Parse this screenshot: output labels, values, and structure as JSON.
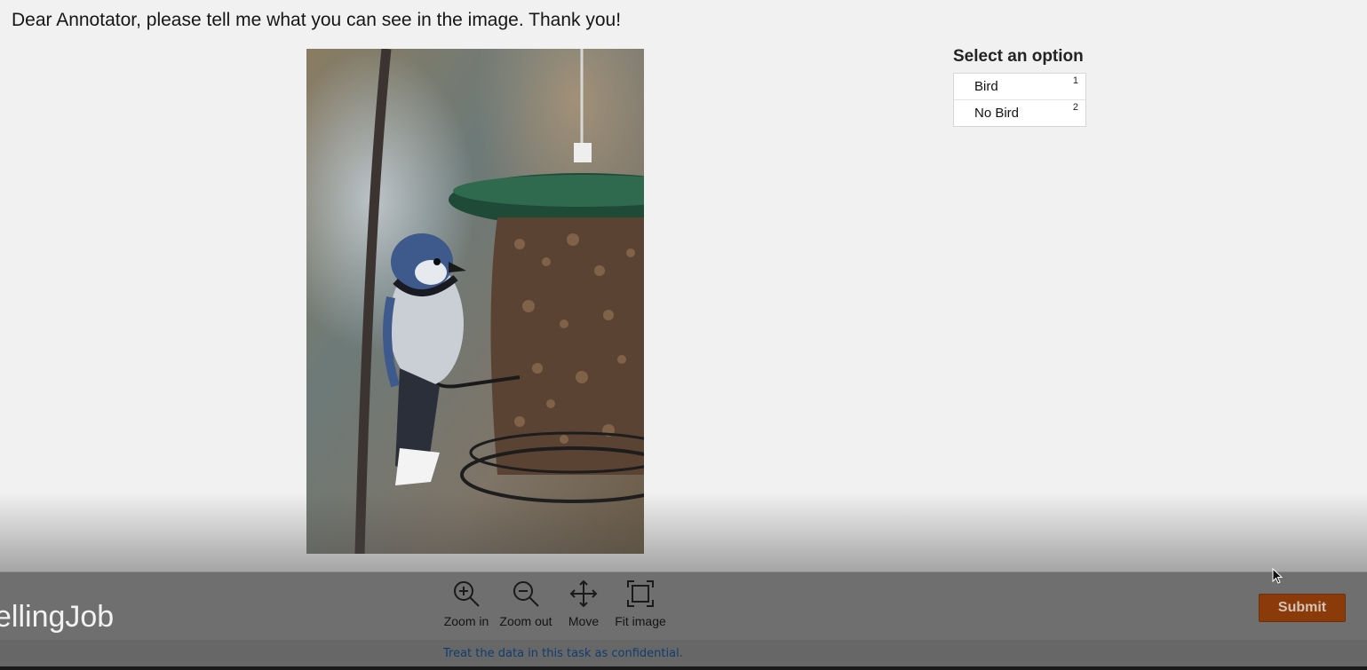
{
  "instructions": "Dear Annotator, please tell me what you can see in the image. Thank you!",
  "options": {
    "title": "Select an option",
    "items": [
      {
        "label": "Bird",
        "key": "1"
      },
      {
        "label": "No Bird",
        "key": "2"
      }
    ]
  },
  "job_title": "ellingJob",
  "tools": {
    "zoom_in": "Zoom in",
    "zoom_out": "Zoom out",
    "move": "Move",
    "fit_image": "Fit image"
  },
  "submit_label": "Submit",
  "footer_note": "Treat the data in this task as confidential.",
  "colors": {
    "submit": "#8a3b09",
    "toolbar": "#6f6f6f",
    "footer_text": "#0f3d6e"
  }
}
